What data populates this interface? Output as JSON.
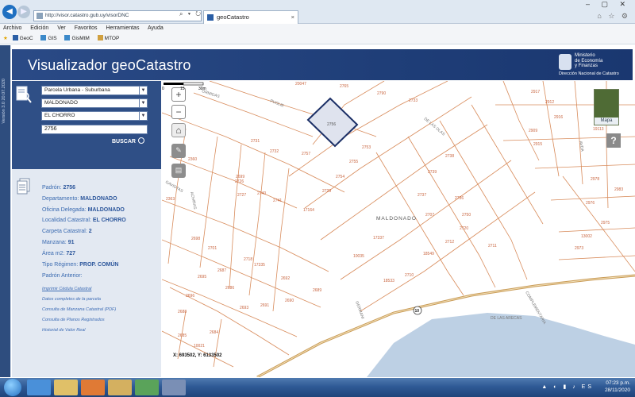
{
  "browser": {
    "address": "http://visor.catastro.gub.uy/visorDNC",
    "address_tools": "⌕ ▾ ↻ ✕",
    "tab_title": "geoCatastro",
    "menu": [
      "Archivo",
      "Edición",
      "Ver",
      "Favoritos",
      "Herramientas",
      "Ayuda"
    ],
    "favorites": [
      "GeoC",
      "GIS",
      "GisMtM",
      "MTOP"
    ]
  },
  "app": {
    "side_strip_text": "Versión 3.0 20.07.2020",
    "title": "Visualizador geoCatastro",
    "ministry_line1": "Ministerio",
    "ministry_line2": "de Economía",
    "ministry_line3": "y Finanzas",
    "ministry_sub": "Dirección Nacional de Catastro"
  },
  "search": {
    "type": "Parcela Urbana - Suburbana",
    "department": "MALDONADO",
    "locality": "EL CHORRO",
    "padron_value": "2756",
    "button_label": "BUSCAR"
  },
  "info": {
    "padron": "2756",
    "departamento": "MALDONADO",
    "oficina": "MALDONADO",
    "localidad": "EL CHORRO",
    "carpeta": "2",
    "manzana": "91",
    "area": "727",
    "regimen": "PROP. COMÚN",
    "labels": {
      "padron": "Padrón: ",
      "departamento": "Departamento: ",
      "oficina": "Oficina Delegada: ",
      "localidad": "Localidad Catastral: ",
      "carpeta": "Carpeta Catastral: ",
      "manzana": "Manzana: ",
      "area": "Área m2: ",
      "regimen": "Tipo Régimen: ",
      "padron_anterior": "Padrón Anterior:"
    },
    "links": [
      "Imprimir Cédula Catastral",
      "Datos completos de la parcela",
      "Consulta de Manzana Catastral (PDF)",
      "Consulta de Planos Registrados",
      "Historial de Valor Real"
    ]
  },
  "map": {
    "thumb_label": "Mapa",
    "help": "?",
    "coords": "X: 693502, Y: 6133502",
    "scale_labels": [
      "0",
      "15",
      "30m"
    ],
    "area_label": "MALDONADO",
    "parcel_labels": [
      "20047",
      "2765",
      "2733",
      "2790",
      "2753",
      "2757",
      "2756",
      "2755",
      "2754",
      "2729",
      "2731",
      "2732",
      "2726",
      "2727",
      "2740",
      "2741",
      "2739",
      "2738",
      "2737",
      "2736",
      "17164",
      "2707",
      "2720",
      "2711",
      "2712",
      "2718",
      "17337",
      "18549",
      "10035",
      "2710",
      "18533",
      "2750",
      "2699",
      "2701",
      "2698",
      "2695",
      "2696",
      "2693",
      "2691",
      "2690",
      "2689",
      "2688",
      "2687",
      "2686",
      "2685",
      "2684",
      "17335",
      "2692",
      "2360",
      "2363",
      "2912",
      "2915",
      "2916",
      "2909",
      "2976",
      "2983",
      "2978",
      "2975",
      "2973",
      "13002",
      "19113",
      "2917",
      "10021"
    ],
    "route_badge": "10",
    "street_labels": [
      "ORMIDAS",
      "PUGLIE",
      "DE LAS OLAS",
      "ACHIRAS",
      "GAVIOTAS",
      "COMPLEMENTARIA",
      "GERMANI",
      "AVDA",
      "DE LAS ARECAS"
    ]
  },
  "taskbar": {
    "time": "07:23 p.m.",
    "date": "28/11/2020",
    "tray": "▲ ◐ ▮ ♪ ES"
  }
}
